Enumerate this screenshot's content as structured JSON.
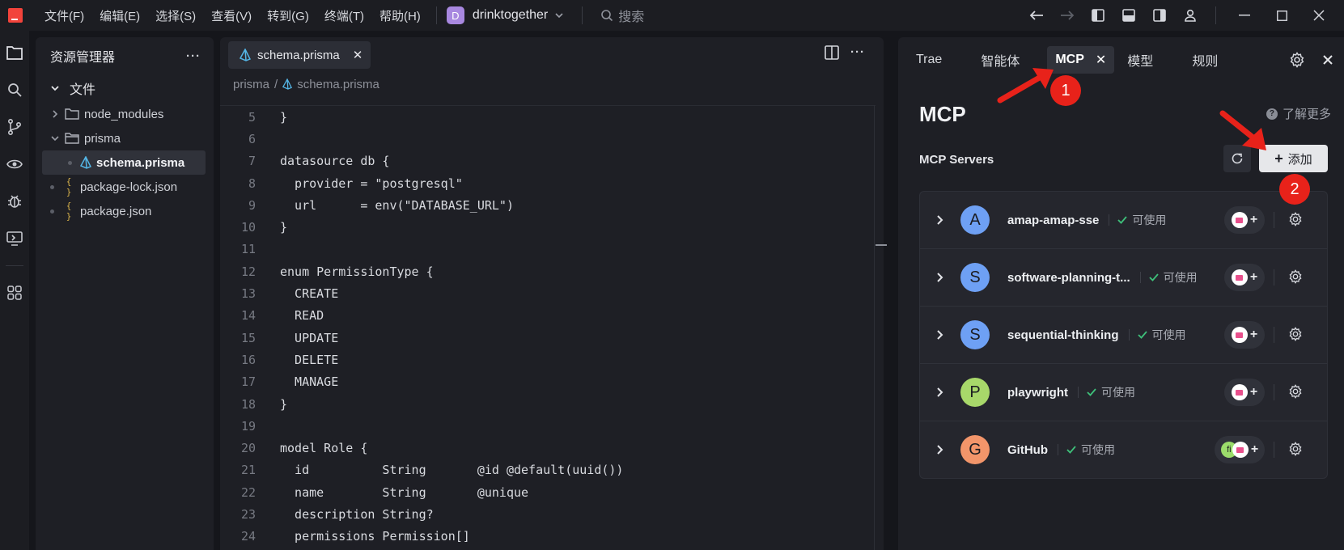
{
  "menu": [
    "文件(F)",
    "编辑(E)",
    "选择(S)",
    "查看(V)",
    "转到(G)",
    "终端(T)",
    "帮助(H)"
  ],
  "project": {
    "badge": "D",
    "name": "drinktogether"
  },
  "search": {
    "placeholder": "搜索"
  },
  "explorer": {
    "title": "资源管理器",
    "more": "···",
    "root": "文件",
    "items": [
      {
        "label": "node_modules",
        "type": "folder",
        "expanded": false
      },
      {
        "label": "prisma",
        "type": "folder",
        "expanded": true
      },
      {
        "label": "schema.prisma",
        "type": "prisma",
        "selected": true
      },
      {
        "label": "package-lock.json",
        "type": "json",
        "icon_text": "{ }"
      },
      {
        "label": "package.json",
        "type": "json",
        "icon_text": "{ }"
      }
    ]
  },
  "editor": {
    "tab": {
      "label": "schema.prisma",
      "close": "✕"
    },
    "breadcrumb": {
      "folder": "prisma",
      "separator": "/",
      "file": "schema.prisma"
    },
    "more": "···",
    "lines": [
      {
        "n": "5",
        "text": "}"
      },
      {
        "n": "6",
        "text": ""
      },
      {
        "n": "7",
        "text": "datasource db {"
      },
      {
        "n": "8",
        "text": "  provider = \"postgresql\""
      },
      {
        "n": "9",
        "text": "  url      = env(\"DATABASE_URL\")"
      },
      {
        "n": "10",
        "text": "}"
      },
      {
        "n": "11",
        "text": ""
      },
      {
        "n": "12",
        "text": "enum PermissionType {"
      },
      {
        "n": "13",
        "text": "  CREATE"
      },
      {
        "n": "14",
        "text": "  READ"
      },
      {
        "n": "15",
        "text": "  UPDATE"
      },
      {
        "n": "16",
        "text": "  DELETE"
      },
      {
        "n": "17",
        "text": "  MANAGE"
      },
      {
        "n": "18",
        "text": "}"
      },
      {
        "n": "19",
        "text": ""
      },
      {
        "n": "20",
        "text": "model Role {"
      },
      {
        "n": "21",
        "text": "  id          String       @id @default(uuid())"
      },
      {
        "n": "22",
        "text": "  name        String       @unique"
      },
      {
        "n": "23",
        "text": "  description String?"
      },
      {
        "n": "24",
        "text": "  permissions Permission[]"
      }
    ]
  },
  "panel": {
    "tabs": [
      "Trae",
      "智能体",
      "MCP",
      "模型",
      "规则"
    ],
    "active_tab": "MCP",
    "close": "✕",
    "title": "MCP",
    "learn_more": "了解更多",
    "learn_icon": "?",
    "servers_label": "MCP Servers",
    "add_label": "添加",
    "add_plus": "+",
    "servers": [
      {
        "letter": "A",
        "name": "amap-amap-sse",
        "status": "可使用",
        "color": "#6ea0f4",
        "pill": "+"
      },
      {
        "letter": "S",
        "name": "software-planning-t...",
        "status": "可使用",
        "color": "#6ea0f4",
        "pill": "+"
      },
      {
        "letter": "S",
        "name": "sequential-thinking",
        "status": "可使用",
        "color": "#6ea0f4",
        "pill": "+"
      },
      {
        "letter": "P",
        "name": "playwright",
        "status": "可使用",
        "color": "#a8d86a",
        "pill": "+"
      },
      {
        "letter": "G",
        "name": "GitHub",
        "status": "可使用",
        "color": "#f2956a",
        "pill": "+",
        "extra_avatar": "fi"
      }
    ]
  },
  "annotations": [
    {
      "label": "1"
    },
    {
      "label": "2"
    }
  ],
  "colors": {
    "accent_red": "#e8221a",
    "ok_green": "#3ec07a",
    "logo": "#f2433b"
  }
}
